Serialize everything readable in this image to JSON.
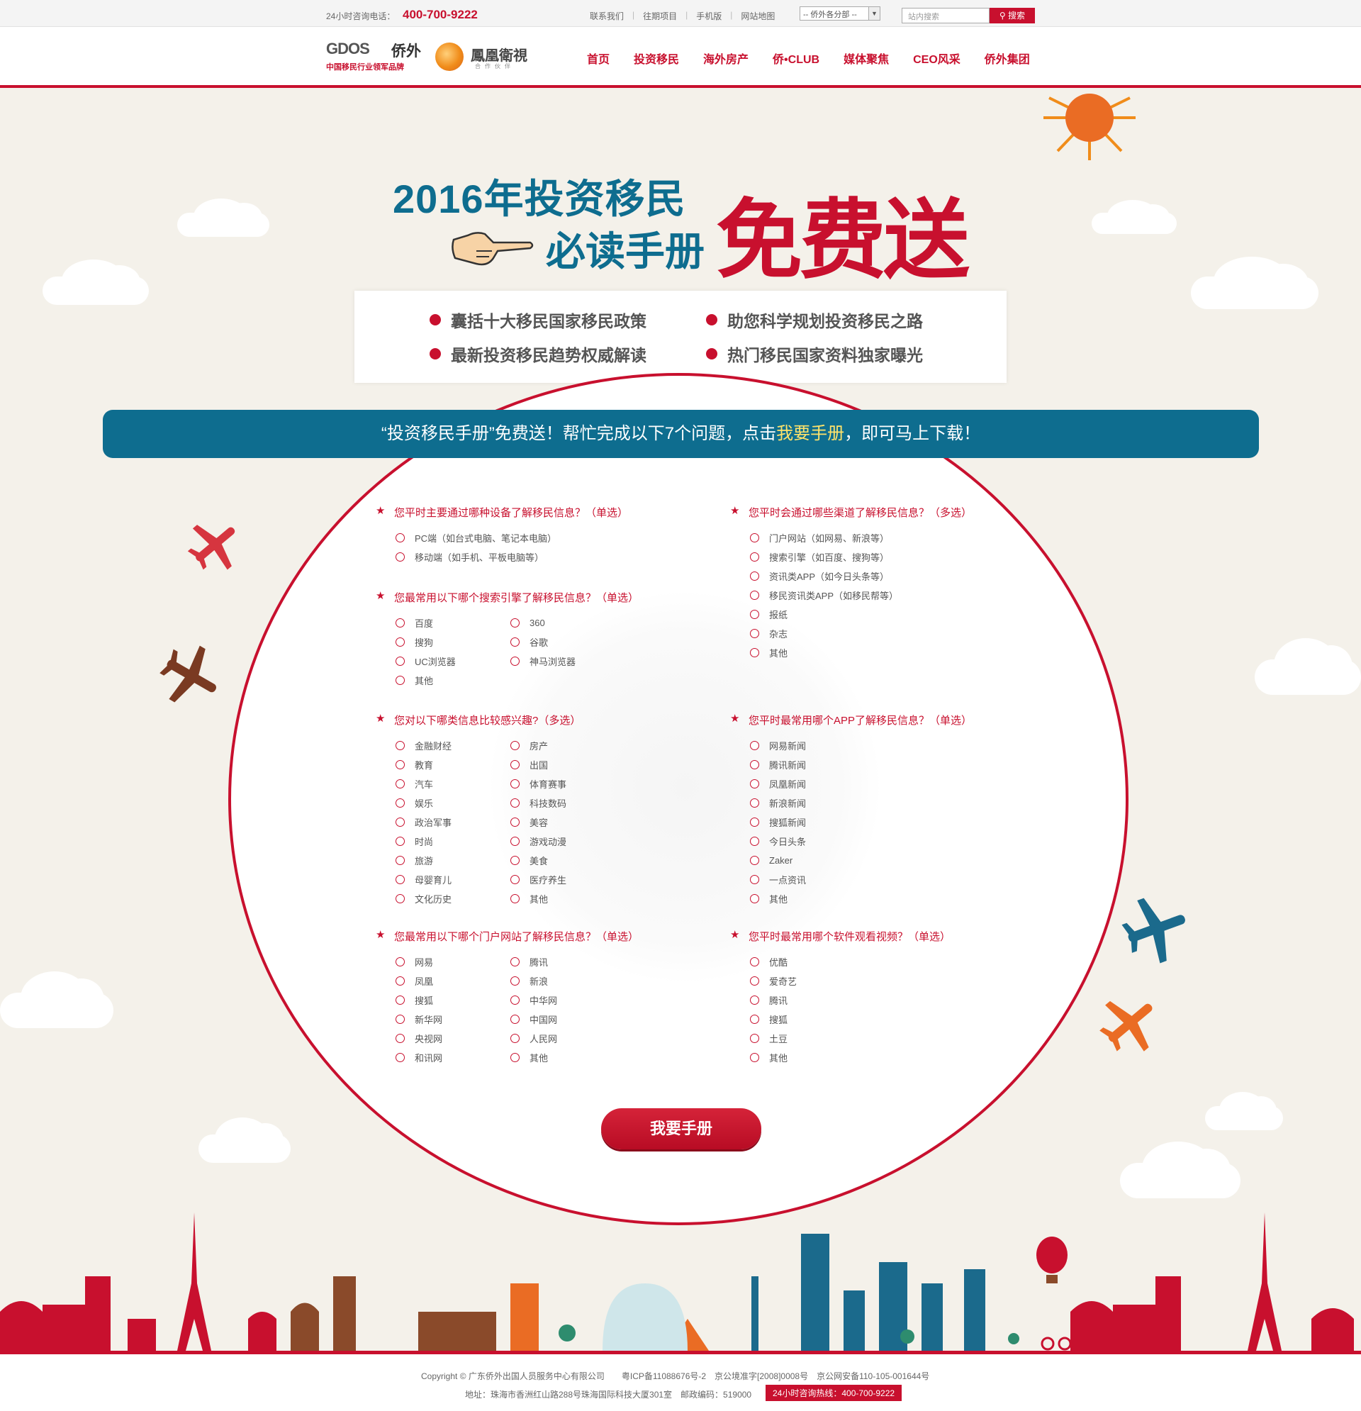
{
  "topbar": {
    "hotline_label": "24小时咨询电话：",
    "hotline_number": "400-700-9222",
    "links": [
      "联系我们",
      "往期项目",
      "手机版",
      "网站地图"
    ],
    "branch_select": "-- 侨外各分部 --",
    "search_placeholder": "站内搜索",
    "search_button": "搜索"
  },
  "header": {
    "logo_gdos": "GDOS",
    "logo_qiaowai": "侨外",
    "logo_slogan": "中国移民行业领军品牌",
    "partner_name": "鳳凰衛視",
    "partner_sub": "合作伙伴",
    "nav": [
      "首页",
      "投资移民",
      "海外房产",
      "侨•CLUB",
      "媒体聚焦",
      "CEO风采",
      "侨外集团"
    ]
  },
  "hero": {
    "line1": "2016年投资移民",
    "line2": "必读手册",
    "free": "免费送",
    "features": [
      "囊括十大移民国家移民政策",
      "助您科学规划投资移民之路",
      "最新投资移民趋势权威解读",
      "热门移民国家资料独家曝光"
    ]
  },
  "banner": {
    "part1": "“投资移民手册”免费送！帮忙完成以下7个问题，点击",
    "highlight": "我要手册",
    "part2": "，即可马上下载！"
  },
  "questions": {
    "q1": {
      "title": "您平时主要通过哪种设备了解移民信息？（单选）",
      "options": [
        "PC端（如台式电脑、笔记本电脑）",
        "移动端（如手机、平板电脑等）"
      ]
    },
    "q2": {
      "title": "您最常用以下哪个搜索引擎了解移民信息？（单选）",
      "options": [
        "百度",
        "360",
        "搜狗",
        "谷歌",
        "UC浏览器",
        "神马浏览器",
        "其他"
      ]
    },
    "q3": {
      "title": "您对以下哪类信息比较感兴趣?（多选）",
      "options": [
        "金融财经",
        "房产",
        "教育",
        "出国",
        "汽车",
        "体育赛事",
        "娱乐",
        "科技数码",
        "政治军事",
        "美容",
        "时尚",
        "游戏动漫",
        "旅游",
        "美食",
        "母婴育儿",
        "医疗养生",
        "文化历史",
        "其他"
      ]
    },
    "q4": {
      "title": "您最常用以下哪个门户网站了解移民信息？（单选）",
      "options": [
        "网易",
        "腾讯",
        "凤凰",
        "新浪",
        "搜狐",
        "中华网",
        "新华网",
        "中国网",
        "央视网",
        "人民网",
        "和讯网",
        "其他"
      ]
    },
    "q5": {
      "title": "您平时会通过哪些渠道了解移民信息？（多选）",
      "options": [
        "门户网站（如网易、新浪等）",
        "搜索引擎（如百度、搜狗等）",
        "资讯类APP（如今日头条等）",
        "移民资讯类APP（如移民帮等）",
        "报纸",
        "杂志",
        "其他"
      ]
    },
    "q6": {
      "title": "您平时最常用哪个APP了解移民信息？（单选）",
      "options": [
        "网易新闻",
        "腾讯新闻",
        "凤凰新闻",
        "新浪新闻",
        "搜狐新闻",
        "今日头条",
        "Zaker",
        "一点资讯",
        "其他"
      ]
    },
    "q7": {
      "title": "您平时最常用哪个软件观看视频？（单选）",
      "options": [
        "优酷",
        "爱奇艺",
        "腾讯",
        "搜狐",
        "土豆",
        "其他"
      ]
    }
  },
  "submit_label": "我要手册",
  "footer": {
    "copyright": "Copyright © 广东侨外出国人员服务中心有限公司　　粤ICP备11088676号-2　京公境准字[2008]0008号　京公网安备110-105-001644号",
    "address": "地址：珠海市香洲红山路288号珠海国际科技大厦301室　邮政编码：519000",
    "hotline": "24小时咨询热线：400-700-9222"
  },
  "colors": {
    "brand_red": "#c8102e",
    "brand_blue": "#0e6d8f",
    "background": "#f4f1ea"
  }
}
